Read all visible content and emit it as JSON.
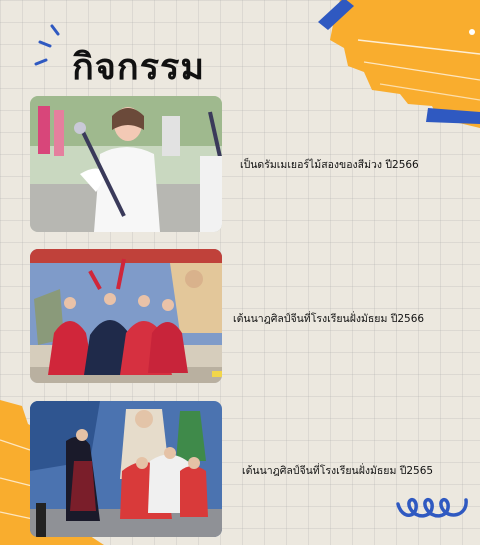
{
  "page": {
    "title": "กิจกรรม"
  },
  "colors": {
    "accent_orange": "#f9ad2e",
    "accent_blue": "#2f59c1",
    "background": "#ece8df"
  },
  "activities": [
    {
      "caption": "เป็นดรัมเมเยอร์ไม้สองของสีม่วง ปี2566",
      "photo": "drum-major-photo"
    },
    {
      "caption": "เต้นนาฎศิลป์จีนที่โรงเรียนฝั่งมัธยม ปี2566",
      "photo": "chinese-dance-photo"
    },
    {
      "caption": "เต้นนาฎศิลป์จีนที่โรงเรียนฝั่งมัธยม ปี2565",
      "photo": "chinese-dance-photo"
    }
  ]
}
